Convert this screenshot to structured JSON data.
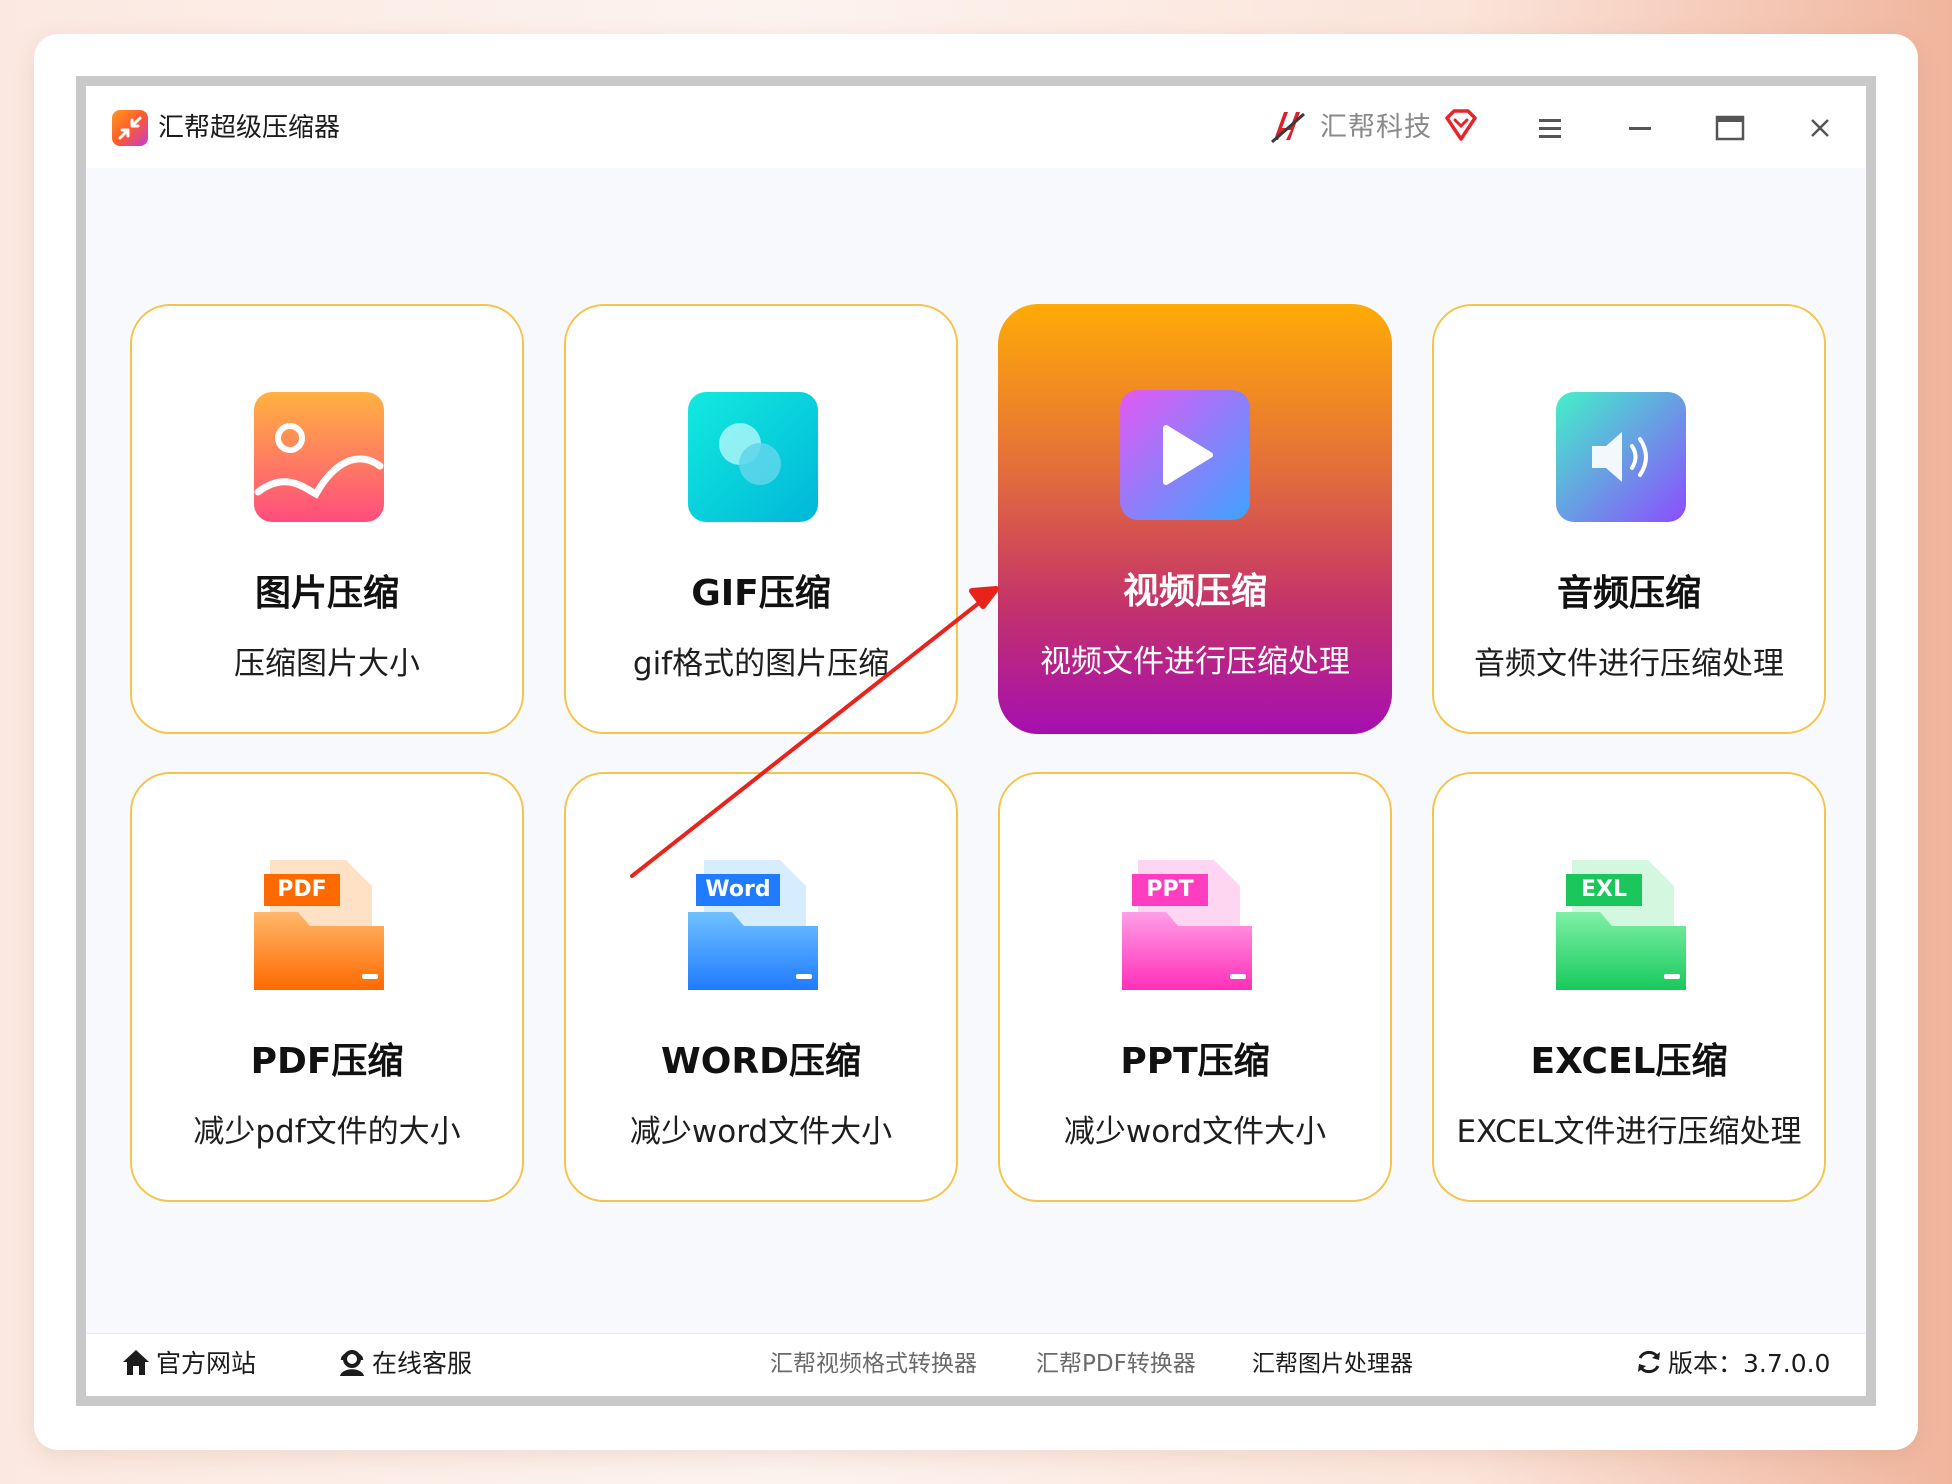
{
  "window": {
    "title": "汇帮超级压缩器",
    "brand": "汇帮科技"
  },
  "icons": {
    "app_logo": "compress-arrows-icon",
    "brand_logo": "huibang-logo-icon",
    "vip": "diamond-heart-icon",
    "menu": "hamburger-icon",
    "minimize": "minimize-icon",
    "maximize": "maximize-icon",
    "close": "close-icon"
  },
  "cards": [
    {
      "title": "图片压缩",
      "subtitle": "压缩图片大小",
      "icon": "image-icon",
      "active": false
    },
    {
      "title": "GIF压缩",
      "subtitle": "gif格式的图片压缩",
      "icon": "gif-icon",
      "active": false
    },
    {
      "title": "视频压缩",
      "subtitle": "视频文件进行压缩处理",
      "icon": "video-play-icon",
      "active": true
    },
    {
      "title": "音频压缩",
      "subtitle": "音频文件进行压缩处理",
      "icon": "audio-speaker-icon",
      "active": false
    },
    {
      "title": "PDF压缩",
      "subtitle": "减少pdf文件的大小",
      "icon": "pdf-folder-icon",
      "badge": "PDF",
      "active": false
    },
    {
      "title": "WORD压缩",
      "subtitle": "减少word文件大小",
      "icon": "word-folder-icon",
      "badge": "Word",
      "active": false
    },
    {
      "title": "PPT压缩",
      "subtitle": "减少word文件大小",
      "icon": "ppt-folder-icon",
      "badge": "PPT",
      "active": false
    },
    {
      "title": "EXCEL压缩",
      "subtitle": "EXCEL文件进行压缩处理",
      "icon": "excel-folder-icon",
      "badge": "EXL",
      "active": false
    }
  ],
  "colors": {
    "card_border": "#f5c44a",
    "active_gradient_top": "#ffab06",
    "active_gradient_bottom": "#a50fb0",
    "annotation_arrow": "#e8231c"
  },
  "statusbar": {
    "home_link": "官方网站",
    "support_link": "在线客服",
    "video_converter": "汇帮视频格式转换器",
    "pdf_converter": "汇帮PDF转换器",
    "image_processor": "汇帮图片处理器",
    "version": "版本：3.7.0.0"
  }
}
